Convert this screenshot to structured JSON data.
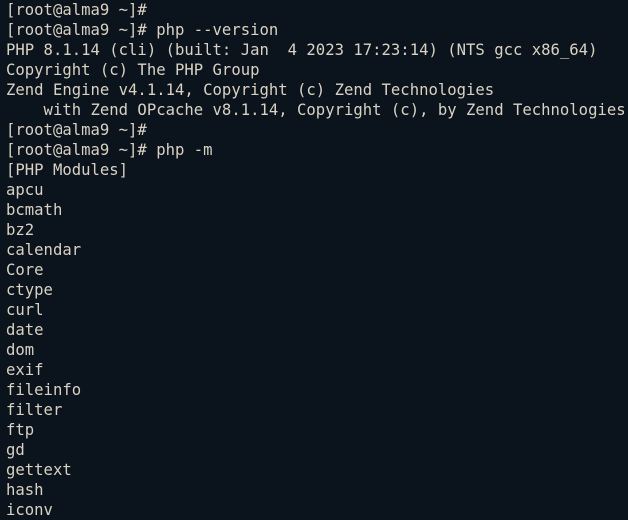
{
  "terminal": {
    "type": "shell-session",
    "theme": {
      "background": "#0b131c",
      "foreground": "#d9d2c4"
    },
    "prompt": "[root@alma9 ~]#",
    "font_size_px": 15.6,
    "line_height_px": 20,
    "columns": 66,
    "rows": 26,
    "lines": [
      "[root@alma9 ~]#",
      "[root@alma9 ~]# php --version",
      "PHP 8.1.14 (cli) (built: Jan  4 2023 17:23:14) (NTS gcc x86_64)",
      "Copyright (c) The PHP Group",
      "Zend Engine v4.1.14, Copyright (c) Zend Technologies",
      "    with Zend OPcache v8.1.14, Copyright (c), by Zend Technologies",
      "[root@alma9 ~]#",
      "[root@alma9 ~]# php -m",
      "[PHP Modules]",
      "apcu",
      "bcmath",
      "bz2",
      "calendar",
      "Core",
      "ctype",
      "curl",
      "date",
      "dom",
      "exif",
      "fileinfo",
      "filter",
      "ftp",
      "gd",
      "gettext",
      "hash",
      "iconv"
    ],
    "commands": [
      "php --version",
      "php -m"
    ],
    "php_version_info": {
      "version": "8.1.14",
      "sapi": "cli",
      "build_date": "Jan  4 2023 17:23:14",
      "thread_safety": "NTS",
      "compiler": "gcc",
      "architecture": "x86_64",
      "copyright": "Copyright (c) The PHP Group",
      "zend_engine": "v4.1.14",
      "zend_opcache": "v8.1.14"
    },
    "modules_header": "[PHP Modules]",
    "modules": [
      "apcu",
      "bcmath",
      "bz2",
      "calendar",
      "Core",
      "ctype",
      "curl",
      "date",
      "dom",
      "exif",
      "fileinfo",
      "filter",
      "ftp",
      "gd",
      "gettext",
      "hash",
      "iconv"
    ]
  }
}
